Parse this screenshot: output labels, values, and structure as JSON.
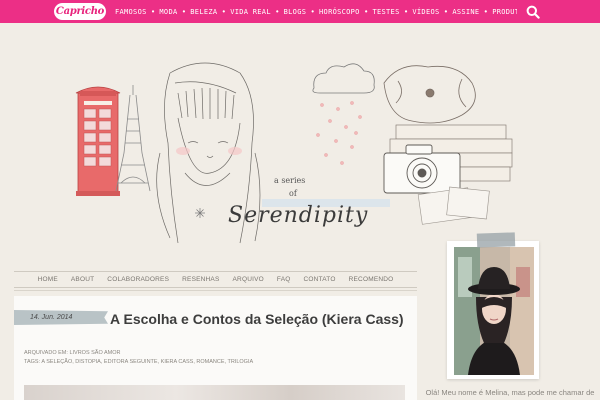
{
  "brand": {
    "logo_text": "Capricho"
  },
  "topnav": {
    "items": [
      "FAMOSOS",
      "MODA",
      "BELEZA",
      "VIDA REAL",
      "BLOGS",
      "HORÓSCOPO",
      "TESTES",
      "VÍDEOS",
      "ASSINE",
      "PRODUTOS CH"
    ]
  },
  "header": {
    "tagline_a": "a series",
    "tagline_of": "of",
    "title": "Serendipity"
  },
  "mainnav": {
    "items": [
      "HOME",
      "ABOUT",
      "COLABORADORES",
      "RESENHAS",
      "ARQUIVO",
      "FAQ",
      "CONTATO",
      "RECOMENDO"
    ]
  },
  "post": {
    "date": "14. Jun. 2014",
    "title": "A Escolha e Contos da Seleção (Kiera Cass)",
    "archived_label": "ARQUIVADO EM:",
    "archived_value": "LIVROS SÃO AMOR",
    "tags_label": "TAGS:",
    "tags_value": "A SELEÇÃO, DISTOPIA, EDITORA SEGUINTE, KIERA CASS, ROMANCE, TRILOGIA"
  },
  "sidebar": {
    "bio": "Olá! Meu nome é Melina, mas pode me chamar de"
  },
  "colors": {
    "topbar": "#ec2f86",
    "page_bg": "#f1ede6",
    "tape": "#b9c3c6"
  }
}
